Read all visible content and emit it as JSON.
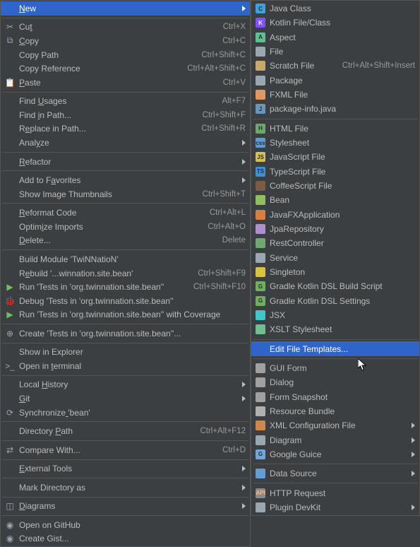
{
  "left": {
    "sections": [
      [
        {
          "id": "new",
          "label": "New",
          "shortcut": "",
          "icon": "",
          "arrow": true,
          "hl": true,
          "u": 0
        }
      ],
      [
        {
          "id": "cut",
          "label": "Cut",
          "shortcut": "Ctrl+X",
          "icon": "✂",
          "u": 2
        },
        {
          "id": "copy",
          "label": "Copy",
          "shortcut": "Ctrl+C",
          "icon": "⧉",
          "u": 0
        },
        {
          "id": "copy-path",
          "label": "Copy Path",
          "shortcut": "Ctrl+Shift+C"
        },
        {
          "id": "copy-ref",
          "label": "Copy Reference",
          "shortcut": "Ctrl+Alt+Shift+C"
        },
        {
          "id": "paste",
          "label": "Paste",
          "shortcut": "Ctrl+V",
          "icon": "📋",
          "u": 0
        }
      ],
      [
        {
          "id": "find-usages",
          "label": "Find Usages",
          "shortcut": "Alt+F7",
          "u": 5
        },
        {
          "id": "find-in-path",
          "label": "Find in Path...",
          "shortcut": "Ctrl+Shift+F",
          "u": 5
        },
        {
          "id": "replace-in-path",
          "label": "Replace in Path...",
          "shortcut": "Ctrl+Shift+R",
          "u": 1
        },
        {
          "id": "analyze",
          "label": "Analyze",
          "arrow": true,
          "u": 4
        }
      ],
      [
        {
          "id": "refactor",
          "label": "Refactor",
          "arrow": true,
          "u": 0
        }
      ],
      [
        {
          "id": "add-fav",
          "label": "Add to Favorites",
          "arrow": true,
          "u": 8
        },
        {
          "id": "show-thumbs",
          "label": "Show Image Thumbnails",
          "shortcut": "Ctrl+Shift+T"
        }
      ],
      [
        {
          "id": "reformat",
          "label": "Reformat Code",
          "shortcut": "Ctrl+Alt+L",
          "u": 0
        },
        {
          "id": "opt-imports",
          "label": "Optimize Imports",
          "shortcut": "Ctrl+Alt+O",
          "u": 5
        },
        {
          "id": "delete",
          "label": "Delete...",
          "shortcut": "Delete",
          "u": 0
        }
      ],
      [
        {
          "id": "build-mod",
          "label": "Build Module 'TwiNNatioN'"
        },
        {
          "id": "rebuild",
          "label": "Rebuild '...winnation.site.bean'",
          "shortcut": "Ctrl+Shift+F9",
          "u": 1
        },
        {
          "id": "run",
          "label": "Run 'Tests in 'org.twinnation.site.bean''",
          "shortcut": "Ctrl+Shift+F10",
          "icon": "▶",
          "iconColor": "#6fbf5f"
        },
        {
          "id": "debug",
          "label": "Debug 'Tests in 'org.twinnation.site.bean''",
          "icon": "🐞",
          "iconColor": "#6fbf5f"
        },
        {
          "id": "coverage",
          "label": "Run 'Tests in 'org.twinnation.site.bean'' with Coverage",
          "icon": "▶",
          "iconColor": "#6fbf5f"
        }
      ],
      [
        {
          "id": "create-tests",
          "label": "Create 'Tests in 'org.twinnation.site.bean''...",
          "icon": "⊕"
        }
      ],
      [
        {
          "id": "show-explorer",
          "label": "Show in Explorer"
        },
        {
          "id": "open-terminal",
          "label": "Open in terminal",
          "icon": ">_",
          "u": 8
        }
      ],
      [
        {
          "id": "local-history",
          "label": "Local History",
          "arrow": true,
          "u": 6
        },
        {
          "id": "git",
          "label": "Git",
          "arrow": true,
          "u": 0
        },
        {
          "id": "sync",
          "label": "Synchronize 'bean'",
          "icon": "⟳",
          "u": 11
        }
      ],
      [
        {
          "id": "dir-path",
          "label": "Directory Path",
          "shortcut": "Ctrl+Alt+F12",
          "u": 10
        }
      ],
      [
        {
          "id": "compare",
          "label": "Compare With...",
          "shortcut": "Ctrl+D",
          "icon": "⇄"
        }
      ],
      [
        {
          "id": "external-tools",
          "label": "External Tools",
          "arrow": true,
          "u": 0
        }
      ],
      [
        {
          "id": "mark-dir",
          "label": "Mark Directory as",
          "arrow": true
        }
      ],
      [
        {
          "id": "diagrams",
          "label": "Diagrams",
          "arrow": true,
          "icon": "◫",
          "u": 0
        }
      ],
      [
        {
          "id": "open-github",
          "label": "Open on GitHub",
          "icon": "◉"
        },
        {
          "id": "create-gist",
          "label": "Create Gist...",
          "icon": "◉"
        }
      ]
    ]
  },
  "right": {
    "sections": [
      [
        {
          "id": "java-class",
          "label": "Java Class",
          "fi": "C",
          "fc": "c-blue"
        },
        {
          "id": "kotlin",
          "label": "Kotlin File/Class",
          "fi": "K",
          "fc": "c-kot"
        },
        {
          "id": "aspect",
          "label": "Aspect",
          "fi": "A",
          "fc": "c-asp"
        },
        {
          "id": "file",
          "label": "File",
          "fi": "",
          "fc": "c-file"
        },
        {
          "id": "scratch",
          "label": "Scratch File",
          "shortcut": "Ctrl+Alt+Shift+Insert",
          "fi": "",
          "fc": "c-scr"
        },
        {
          "id": "package",
          "label": "Package",
          "fi": "",
          "fc": "c-pkg"
        },
        {
          "id": "fxml",
          "label": "FXML File",
          "fi": "",
          "fc": "c-fx"
        },
        {
          "id": "pkg-info",
          "label": "package-info.java",
          "fi": "J",
          "fc": "c-java"
        }
      ],
      [
        {
          "id": "html",
          "label": "HTML File",
          "fi": "H",
          "fc": "c-html"
        },
        {
          "id": "stylesheet",
          "label": "Stylesheet",
          "fi": "css",
          "fc": "c-css"
        },
        {
          "id": "js",
          "label": "JavaScript File",
          "fi": "JS",
          "fc": "c-js"
        },
        {
          "id": "ts",
          "label": "TypeScript File",
          "fi": "TS",
          "fc": "c-ts"
        },
        {
          "id": "coffee",
          "label": "CoffeeScript File",
          "fi": "",
          "fc": "c-cfs"
        },
        {
          "id": "bean",
          "label": "Bean",
          "fi": "",
          "fc": "c-bean"
        },
        {
          "id": "jfxapp",
          "label": "JavaFXApplication",
          "fi": "",
          "fc": "c-jfx"
        },
        {
          "id": "jparepo",
          "label": "JpaRepository",
          "fi": "",
          "fc": "c-repo"
        },
        {
          "id": "restctrl",
          "label": "RestController",
          "fi": "",
          "fc": "c-rest"
        },
        {
          "id": "service",
          "label": "Service",
          "fi": "",
          "fc": "c-svc"
        },
        {
          "id": "singleton",
          "label": "Singleton",
          "fi": "",
          "fc": "c-sing"
        },
        {
          "id": "gradle-build",
          "label": "Gradle Kotlin DSL Build Script",
          "fi": "G",
          "fc": "c-grdl"
        },
        {
          "id": "gradle-settings",
          "label": "Gradle Kotlin DSL Settings",
          "fi": "G",
          "fc": "c-grdl"
        },
        {
          "id": "jsx",
          "label": "JSX",
          "fi": "",
          "fc": "c-jsx"
        },
        {
          "id": "xslt",
          "label": "XSLT Stylesheet",
          "fi": "",
          "fc": "c-xslt"
        }
      ],
      [
        {
          "id": "edit-tpl",
          "label": "Edit File Templates...",
          "hl": true
        }
      ],
      [
        {
          "id": "gui-form",
          "label": "GUI Form",
          "fi": "",
          "fc": "c-gui"
        },
        {
          "id": "dialog",
          "label": "Dialog",
          "fi": "",
          "fc": "c-dlg"
        },
        {
          "id": "form-snap",
          "label": "Form Snapshot",
          "fi": "",
          "fc": "c-snap"
        },
        {
          "id": "res-bundle",
          "label": "Resource Bundle",
          "fi": "",
          "fc": "c-bundle"
        },
        {
          "id": "xml-cfg",
          "label": "XML Configuration File",
          "fi": "",
          "fc": "c-xml",
          "arrow": true
        },
        {
          "id": "diagram",
          "label": "Diagram",
          "fi": "",
          "fc": "c-diag",
          "arrow": true
        },
        {
          "id": "guice",
          "label": "Google Guice",
          "fi": "G",
          "fc": "c-gg",
          "arrow": true
        }
      ],
      [
        {
          "id": "datasource",
          "label": "Data Source",
          "fi": "",
          "fc": "c-ds",
          "arrow": true
        }
      ],
      [
        {
          "id": "http-req",
          "label": "HTTP Request",
          "fi": "API",
          "fc": "c-http"
        },
        {
          "id": "plugin-dev",
          "label": "Plugin DevKit",
          "fi": "",
          "fc": "c-plug",
          "arrow": true
        }
      ]
    ]
  }
}
